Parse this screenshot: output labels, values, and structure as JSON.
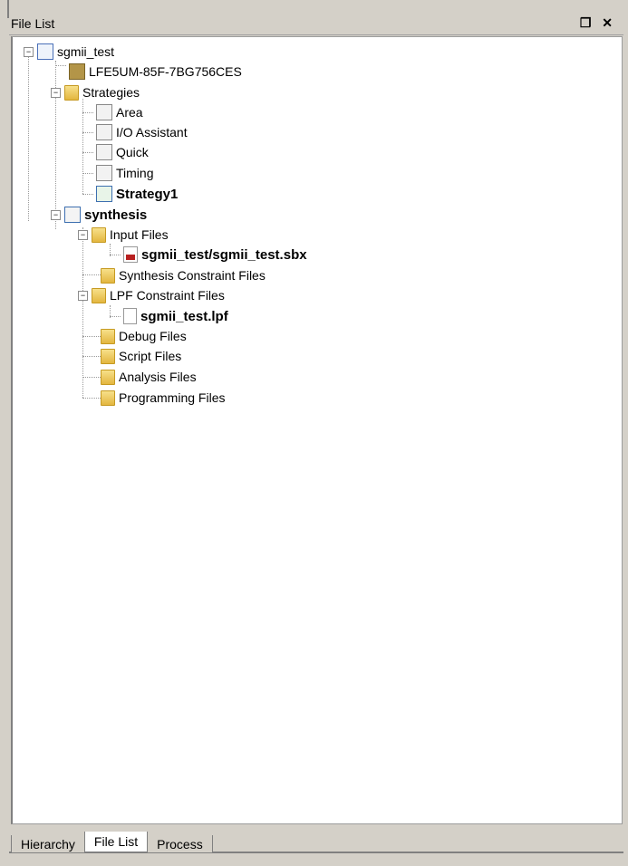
{
  "panel": {
    "title": "File List",
    "restore_glyph": "❐",
    "close_glyph": "✕"
  },
  "tree": {
    "project": "sgmii_test",
    "device": "LFE5UM-85F-7BG756CES",
    "strategies": {
      "label": "Strategies",
      "items": [
        "Area",
        "I/O Assistant",
        "Quick",
        "Timing",
        "Strategy1"
      ]
    },
    "implementation": {
      "label": "synthesis",
      "folders": {
        "input_files": "Input Files",
        "input_file": "sgmii_test/sgmii_test.sbx",
        "synthesis_constraint": "Synthesis Constraint Files",
        "lpf_constraint": "LPF Constraint Files",
        "lpf_file": "sgmii_test.lpf",
        "debug": "Debug Files",
        "script": "Script Files",
        "analysis": "Analysis Files",
        "programming": "Programming Files"
      }
    }
  },
  "tabs": [
    "Hierarchy",
    "File List",
    "Process"
  ],
  "active_tab": "File List"
}
